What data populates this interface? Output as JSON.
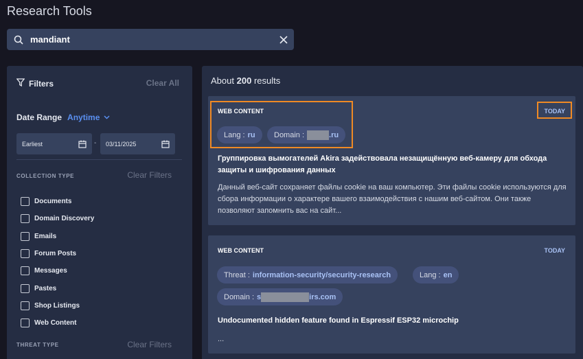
{
  "header": {
    "title": "Research Tools"
  },
  "search": {
    "value": "mandiant",
    "icons": [
      "search-icon",
      "close-icon"
    ]
  },
  "filters": {
    "title": "Filters",
    "clear_all": "Clear All",
    "date_range": {
      "label": "Date Range",
      "value": "Anytime",
      "start": "Earliest",
      "separator": "-",
      "end": "03/11/2025"
    },
    "collection_type": {
      "label": "COLLECTION TYPE",
      "clear": "Clear Filters",
      "items": [
        "Documents",
        "Domain Discovery",
        "Emails",
        "Forum Posts",
        "Messages",
        "Pastes",
        "Shop Listings",
        "Web Content"
      ]
    },
    "threat_type": {
      "label": "THREAT TYPE",
      "clear": "Clear Filters"
    }
  },
  "results": {
    "prefix": "About",
    "count": "200",
    "suffix": "results",
    "cards": [
      {
        "type": "WEB CONTENT",
        "badge": "TODAY",
        "lang_key": "Lang :",
        "lang_val": "ru",
        "domain_key": "Domain :",
        "domain_suffix": ".ru",
        "title": "Группировка вымогателей Akira задействовала незащищённую веб-камеру для обхода защиты и шифрования данных",
        "body": "Данный веб-сайт сохраняет файлы cookie на ваш компьютер. Эти файлы cookie используются для сбора информации о характере вашего взаимодействия с нашим веб-сайтом. Они также позволяют запомнить вас на сайт..."
      },
      {
        "type": "WEB CONTENT",
        "badge": "TODAY",
        "threat_key": "Threat :",
        "threat_val": "information-security/security-research",
        "lang_key": "Lang :",
        "lang_val": "en",
        "domain_key": "Domain :",
        "domain_prefix": "s",
        "domain_suffix": "irs.com",
        "title": "Undocumented hidden feature found in Espressif ESP32 microchip",
        "body": "..."
      }
    ]
  },
  "colors": {
    "accent": "#5a8ff0",
    "highlight": "#f08a24",
    "background": "#161621",
    "panel": "#252d43"
  }
}
